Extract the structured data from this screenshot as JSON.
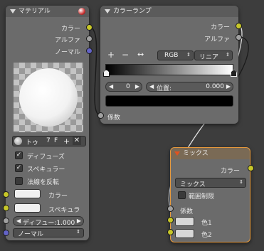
{
  "material_node": {
    "title": "マテリアル",
    "outputs": [
      "カラー",
      "アルファ",
      "ノーマル"
    ],
    "material_name": "トゥ",
    "user_count": "7",
    "fake_user": "F",
    "options": [
      {
        "label": "ディフューズ",
        "checked": true
      },
      {
        "label": "スペキュラー",
        "checked": true
      },
      {
        "label": "法線を反転",
        "checked": false
      }
    ],
    "inputs": {
      "color": "カラー",
      "specular": "スペキュラ",
      "diffuse_field": "ディフュー:1.000",
      "normal_select": "ノーマル"
    }
  },
  "colorramp_node": {
    "title": "カラーランプ",
    "outputs": [
      "カラー",
      "アルファ"
    ],
    "add": "+",
    "remove": "−",
    "flip": "↔",
    "mode": "RGB",
    "interpolation": "リニア",
    "index": "0",
    "position_label": "位置:",
    "position_value": "0.000",
    "input": "係数"
  },
  "mix_node": {
    "title": "ミックス",
    "output": "カラー",
    "blend_mode": "ミックス",
    "clamp_label": "範囲制限",
    "fac": "係数",
    "color1": "色1",
    "color2": "色2"
  },
  "colors": {
    "socket_yellow": "#c7c729",
    "socket_gray": "#a1a1a1",
    "socket_blue": "#6363c7",
    "selected_outline": "#e89a3c"
  }
}
